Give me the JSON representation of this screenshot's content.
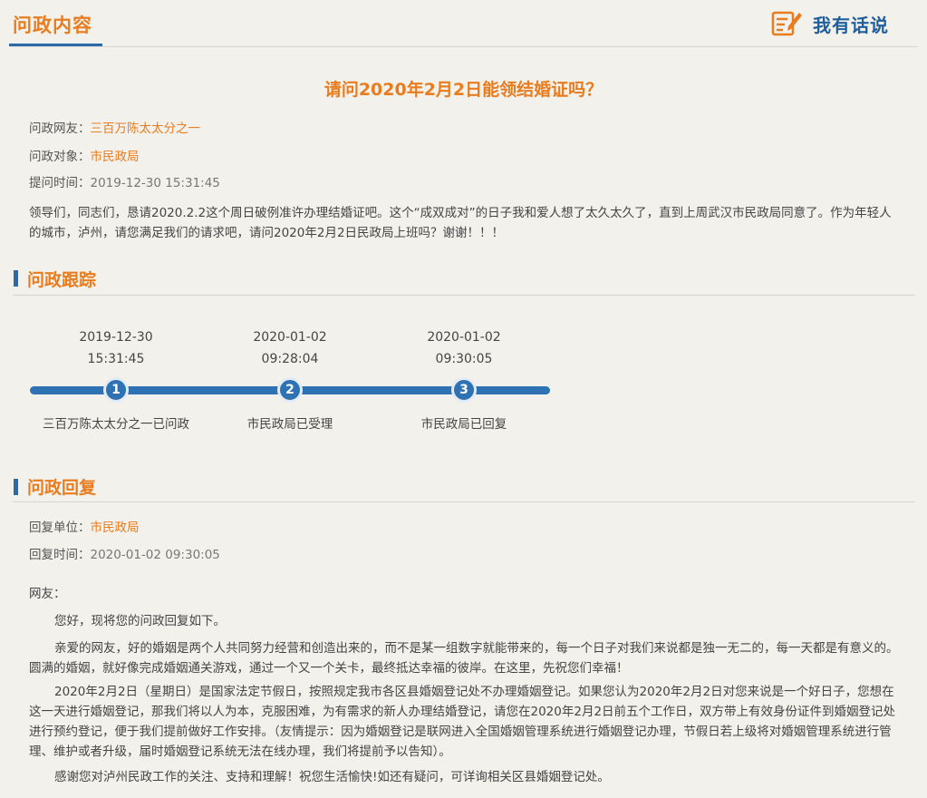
{
  "header": {
    "title": "问政内容",
    "speak_label": "我有话说"
  },
  "question": {
    "title": "请问2020年2月2日能领结婚证吗？",
    "netizen_label": "问政网友：",
    "netizen_value": "三百万陈太太分之一",
    "target_label": "问政对象：",
    "target_value": "市民政局",
    "time_label": "提问时间：",
    "time_value": "2019-12-30 15:31:45",
    "content": "领导们，同志们，恳请2020.2.2这个周日破例准许办理结婚证吧。这个“成双成对”的日子我和爱人想了太久太久了，直到上周武汉市民政局同意了。作为年轻人的城市，泸州，请您满足我们的请求吧，请问2020年2月2日民政局上班吗？谢谢！！！"
  },
  "tracking": {
    "title": "问政跟踪",
    "steps": [
      {
        "date": "2019-12-30",
        "time": "15:31:45",
        "number": "1",
        "caption": "三百万陈太太分之一已问政"
      },
      {
        "date": "2020-01-02",
        "time": "09:28:04",
        "number": "2",
        "caption": "市民政局已受理"
      },
      {
        "date": "2020-01-02",
        "time": "09:30:05",
        "number": "3",
        "caption": "市民政局已回复"
      }
    ]
  },
  "reply": {
    "title": "问政回复",
    "unit_label": "回复单位：",
    "unit_value": "市民政局",
    "time_label": "回复时间：",
    "time_value": "2020-01-02 09:30:05",
    "greeting": "网友：",
    "p1": "您好，现将您的问政回复如下。",
    "p2": "亲爱的网友，好的婚姻是两个人共同努力经营和创造出来的，而不是某一组数字就能带来的，每一个日子对我们来说都是独一无二的，每一天都是有意义的。圆满的婚姻，就好像完成婚姻通关游戏，通过一个又一个关卡，最终抵达幸福的彼岸。在这里，先祝您们幸福！",
    "p3": "2020年2月2日（星期日）是国家法定节假日，按照规定我市各区县婚姻登记处不办理婚姻登记。如果您认为2020年2月2日对您来说是一个好日子，您想在这一天进行婚姻登记，那我们将以人为本，克服困难，为有需求的新人办理结婚登记，请您在2020年2月2日前五个工作日，双方带上有效身份证件到婚姻登记处进行预约登记，便于我们提前做好工作安排。（友情提示：因为婚姻登记是联网进入全国婚姻管理系统进行婚姻登记办理，节假日若上级将对婚姻管理系统进行管理、维护或者升级，届时婚姻登记系统无法在线办理，我们将提前予以告知）。",
    "p4": "感谢您对泸州民政工作的关注、支持和理解！祝您生活愉快!如还有疑问，可详询相关区县婚姻登记处。"
  },
  "colors": {
    "accent_orange": "#e87c1e",
    "accent_blue": "#2a6aa8"
  },
  "icons": {
    "speak": "pencil-note-icon"
  }
}
